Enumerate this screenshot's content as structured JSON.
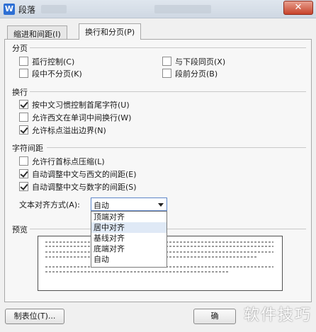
{
  "window": {
    "title": "段落",
    "close_glyph": "✕",
    "app_icon_letter": "W"
  },
  "tabs": [
    {
      "label": "缩进和间距(I)"
    },
    {
      "label": "换行和分页(P)"
    }
  ],
  "pagination": {
    "heading": "分页",
    "options": [
      {
        "label": "孤行控制(C)",
        "checked": false
      },
      {
        "label": "与下段同页(X)",
        "checked": false
      },
      {
        "label": "段中不分页(K)",
        "checked": false
      },
      {
        "label": "段前分页(B)",
        "checked": false
      }
    ]
  },
  "line_break": {
    "heading": "换行",
    "options": [
      {
        "label": "按中文习惯控制首尾字符(U)",
        "checked": true
      },
      {
        "label": "允许西文在单词中间换行(W)",
        "checked": false
      },
      {
        "label": "允许标点溢出边界(N)",
        "checked": true
      }
    ]
  },
  "char_spacing": {
    "heading": "字符间距",
    "options": [
      {
        "label": "允许行首标点压缩(L)",
        "checked": false
      },
      {
        "label": "自动调整中文与西文的间距(E)",
        "checked": true
      },
      {
        "label": "自动调整中文与数字的间距(S)",
        "checked": true
      }
    ],
    "align_label": "文本对齐方式(A):",
    "align_value": "自动",
    "align_options": [
      "顶端对齐",
      "居中对齐",
      "基线对齐",
      "底端对齐",
      "自动"
    ],
    "highlighted_option": 1
  },
  "preview": {
    "heading": "预览"
  },
  "buttons": {
    "tabs_label": "制表位(T)...",
    "ok_label": "确"
  },
  "watermark": "软件技巧"
}
